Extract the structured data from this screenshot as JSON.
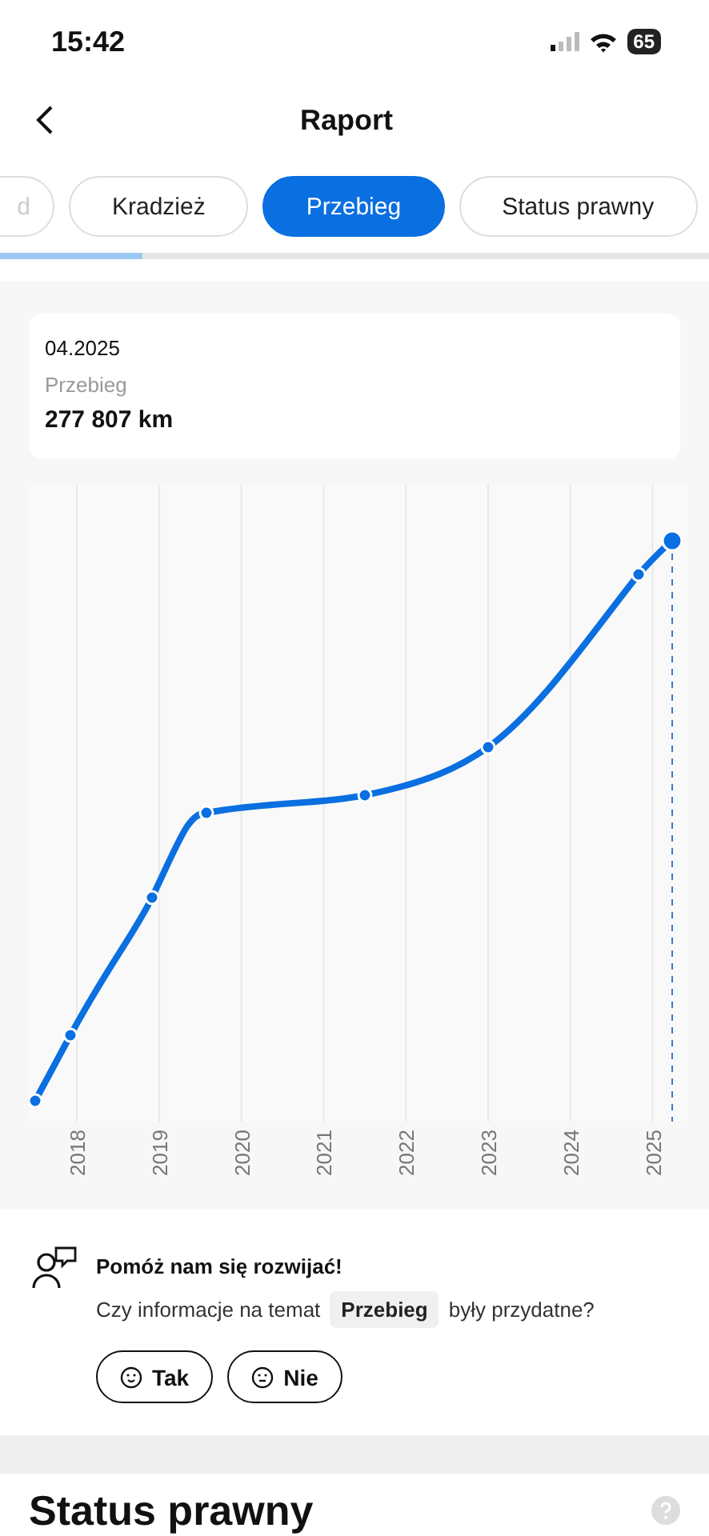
{
  "status_bar": {
    "time": "15:42",
    "battery": "65"
  },
  "header": {
    "title": "Raport"
  },
  "tabs": [
    {
      "label": "d",
      "selected": false
    },
    {
      "label": "Kradzież",
      "selected": false
    },
    {
      "label": "Przebieg",
      "selected": true
    },
    {
      "label": "Status prawny",
      "selected": false
    }
  ],
  "tab_progress": {
    "level": 0.2
  },
  "summary": {
    "date": "04.2025",
    "label": "Przebieg",
    "value": "277 807 km"
  },
  "chart": {
    "x_labels": [
      "2018",
      "2019",
      "2020",
      "2021",
      "2022",
      "2023",
      "2024",
      "2025"
    ]
  },
  "feedback": {
    "title": "Pomóż nam się rozwijać!",
    "question_before": "Czy informacje na temat",
    "topic": "Przebieg",
    "question_after": "były przydatne?",
    "buttons": [
      {
        "label": "Tak",
        "kind": "happy"
      },
      {
        "label": "Nie",
        "kind": "neutral"
      }
    ]
  },
  "next_section": {
    "title": "Status prawny"
  }
}
